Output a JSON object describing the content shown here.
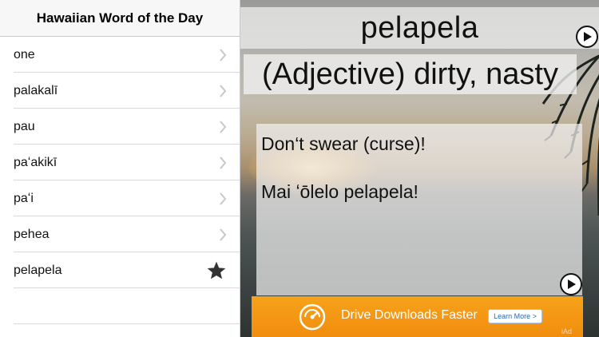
{
  "sidebar": {
    "title": "Hawaiian Word of the Day",
    "items": [
      {
        "label": "one",
        "accessory": "chevron"
      },
      {
        "label": "palakalī",
        "accessory": "chevron"
      },
      {
        "label": "pau",
        "accessory": "chevron"
      },
      {
        "label": "paʻakikī",
        "accessory": "chevron"
      },
      {
        "label": "paʻi",
        "accessory": "chevron"
      },
      {
        "label": "pehea",
        "accessory": "chevron"
      },
      {
        "label": "pelapela",
        "accessory": "star-icon"
      }
    ]
  },
  "detail": {
    "word": "pelapela",
    "definition": "(Adjective) dirty, nasty",
    "example_english": "Don‘t swear (curse)!",
    "example_hawaiian": "Mai ʻōlelo pelapela!"
  },
  "ad": {
    "headline": "Drive Downloads Faster",
    "button_label": "Learn More >",
    "network_label": "iAd",
    "icon": "speedometer-icon"
  },
  "colors": {
    "ad_orange": "#f39311",
    "star": "#333333",
    "chevron": "#c7c7cc"
  }
}
